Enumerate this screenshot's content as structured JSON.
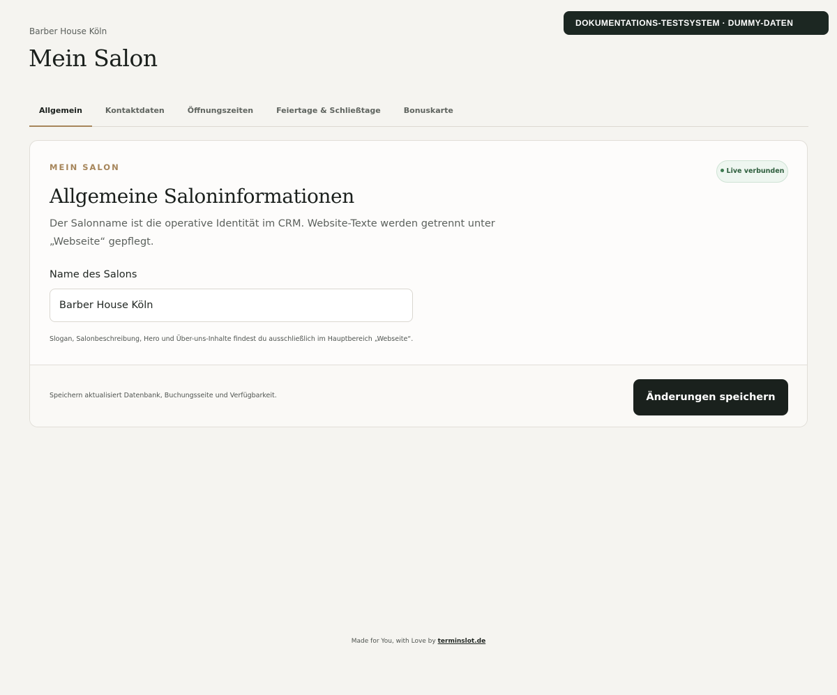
{
  "banner": {
    "text": "DOKUMENTATIONS-TESTSYSTEM · DUMMY-DATEN"
  },
  "header": {
    "breadcrumb": "Barber House Köln",
    "title": "Mein Salon"
  },
  "tabs": [
    {
      "label": "Allgemein",
      "active": true
    },
    {
      "label": "Kontaktdaten",
      "active": false
    },
    {
      "label": "Öffnungszeiten",
      "active": false
    },
    {
      "label": "Feiertage & Schließtage",
      "active": false
    },
    {
      "label": "Bonuskarte",
      "active": false
    }
  ],
  "card": {
    "eyebrow": "MEIN SALON",
    "status_badge": "Live verbunden",
    "title": "Allgemeine Saloninformationen",
    "description": "Der Salonname ist die operative Identität im CRM. Website-Texte werden getrennt unter „Webseite“ gepflegt.",
    "field": {
      "label": "Name des Salons",
      "value": "Barber House Köln",
      "hint": "Slogan, Salonbeschreibung, Hero und Über-uns-Inhalte findest du ausschließlich im Hauptbereich „Webseite“."
    },
    "footer": {
      "note": "Speichern aktualisiert Datenbank, Buchungsseite und Verfügbarkeit.",
      "save_label": "Änderungen speichern"
    }
  },
  "footer": {
    "text": "Made for You, with Love by ",
    "link": "terminslot.de"
  },
  "colors": {
    "background": "#f5f4f0",
    "accent": "#a6855a",
    "dark": "#1a211d",
    "live_green": "#2e5e3d"
  }
}
